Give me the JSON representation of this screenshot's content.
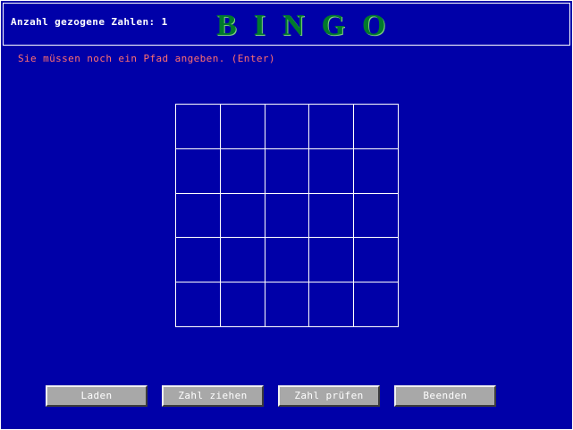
{
  "header": {
    "draw_count_label": "Anzahl gezogene Zahlen:",
    "draw_count_value": "1",
    "title": "BINGO"
  },
  "message": "Sie müssen noch ein Pfad angeben. (Enter)",
  "board": {
    "rows": 5,
    "cols": 5,
    "cells": [
      [
        "",
        "",
        "",
        "",
        ""
      ],
      [
        "",
        "",
        "",
        "",
        ""
      ],
      [
        "",
        "",
        "",
        "",
        ""
      ],
      [
        "",
        "",
        "",
        "",
        ""
      ],
      [
        "",
        "",
        "",
        "",
        ""
      ]
    ]
  },
  "buttons": {
    "load": "Laden",
    "draw": "Zahl ziehen",
    "check": "Zahl prüfen",
    "quit": "Beenden"
  },
  "colors": {
    "background": "#0000a8",
    "title": "#007a2c",
    "message": "#ff6f6f",
    "button_face": "#a8a8a8"
  }
}
